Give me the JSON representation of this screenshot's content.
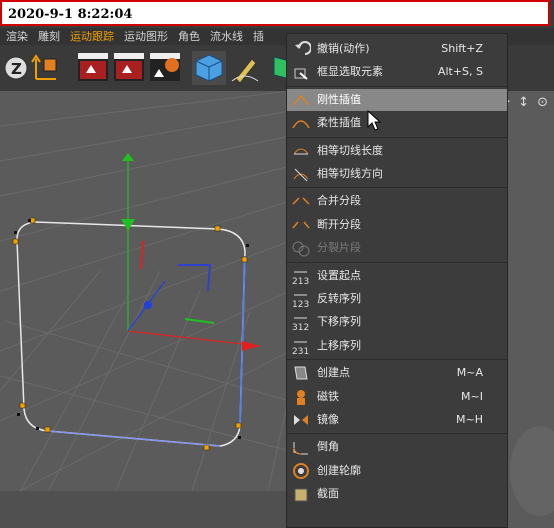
{
  "timestamp": "2020-9-1 8:22:04",
  "menubar": [
    "渲染",
    "雕刻",
    "运动跟踪",
    "运动图形",
    "角色",
    "流水线",
    "插"
  ],
  "menubar_active": "运动跟踪",
  "toolbar_icons": [
    "z-axis-icon",
    "coordinate-system-icon",
    "render-view-icon",
    "render-picture-icon",
    "render-settings-icon",
    "cube-icon",
    "pen-icon",
    "subdivision-icon"
  ],
  "viewport_icons": "✥ ↕ ⊙",
  "menu": {
    "items": [
      {
        "label": "撤销(动作)",
        "shortcut": "Shift+Z",
        "icon": "undo-icon",
        "selected": false,
        "disabled": false
      },
      {
        "label": "框显选取元素",
        "shortcut": "Alt+S, S",
        "icon": "frame-selection-icon",
        "selected": false,
        "disabled": false
      },
      {
        "label": "刚性插值",
        "shortcut": "",
        "icon": "hard-interpolation-icon",
        "selected": true,
        "disabled": false
      },
      {
        "label": "柔性插值",
        "shortcut": "",
        "icon": "soft-interpolation-icon",
        "selected": false,
        "disabled": false
      },
      {
        "label": "相等切线长度",
        "shortcut": "",
        "icon": "equal-tangent-length-icon",
        "selected": false,
        "disabled": false
      },
      {
        "label": "相等切线方向",
        "shortcut": "",
        "icon": "equal-tangent-direction-icon",
        "selected": false,
        "disabled": false
      },
      {
        "label": "合并分段",
        "shortcut": "",
        "icon": "join-segment-icon",
        "selected": false,
        "disabled": false
      },
      {
        "label": "断开分段",
        "shortcut": "",
        "icon": "break-segment-icon",
        "selected": false,
        "disabled": false
      },
      {
        "label": "分裂片段",
        "shortcut": "",
        "icon": "explode-segments-icon",
        "selected": false,
        "disabled": true
      },
      {
        "label": "设置起点",
        "shortcut": "",
        "icon": "set-first-point-icon",
        "selected": false,
        "disabled": false
      },
      {
        "label": "反转序列",
        "shortcut": "",
        "icon": "reverse-sequence-icon",
        "selected": false,
        "disabled": false
      },
      {
        "label": "下移序列",
        "shortcut": "",
        "icon": "move-down-sequence-icon",
        "selected": false,
        "disabled": false
      },
      {
        "label": "上移序列",
        "shortcut": "",
        "icon": "move-up-sequence-icon",
        "selected": false,
        "disabled": false
      },
      {
        "label": "创建点",
        "shortcut": "M~A",
        "icon": "create-point-icon",
        "selected": false,
        "disabled": false
      },
      {
        "label": "磁铁",
        "shortcut": "M~I",
        "icon": "magnet-icon",
        "selected": false,
        "disabled": false
      },
      {
        "label": "镜像",
        "shortcut": "M~H",
        "icon": "mirror-icon",
        "selected": false,
        "disabled": false
      },
      {
        "label": "倒角",
        "shortcut": "",
        "icon": "chamfer-icon",
        "selected": false,
        "disabled": false
      },
      {
        "label": "创建轮廓",
        "shortcut": "",
        "icon": "create-outline-icon",
        "selected": false,
        "disabled": false
      },
      {
        "label": "截面",
        "shortcut": "",
        "icon": "cross-section-icon",
        "selected": false,
        "disabled": false
      }
    ]
  },
  "colors": {
    "accent": "#f0a000",
    "selection": "#888888",
    "x_axis": "#e02020",
    "y_axis": "#20c020",
    "z_axis": "#2040e0"
  }
}
